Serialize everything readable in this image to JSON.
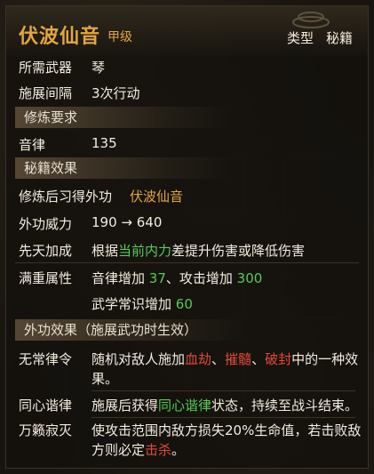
{
  "title": "伏波仙音",
  "grade": "甲级",
  "type": {
    "label": "类型",
    "value": "秘籍"
  },
  "rows": {
    "weapon": {
      "key": "所需武器",
      "value": "琴"
    },
    "interval": {
      "key": "施展间隔",
      "value": "3次行动"
    }
  },
  "sections": {
    "training": "修炼要求",
    "book_effect": "秘籍效果",
    "ext_effect": "外功效果（施展武功时生效）"
  },
  "training": {
    "key": "音律",
    "value": "135"
  },
  "book": {
    "obtain_key": "修炼后习得外功",
    "obtain_value": "伏波仙音",
    "power_key": "外功威力",
    "power_value": "190 → 640",
    "bonus_key": "先天加成",
    "bonus_pre": "根据",
    "bonus_hl": "当前内力",
    "bonus_post": "差提升伤害或降低伤害",
    "maxattr_key": "满重属性",
    "maxattr_l1_a": "音律增加 ",
    "maxattr_l1_b": "37",
    "maxattr_l1_c": "、攻击增加 ",
    "maxattr_l1_d": "300",
    "maxattr_l2_a": "武学常识增加 ",
    "maxattr_l2_b": "60"
  },
  "effects": [
    {
      "key": "无常律令",
      "l1_a": "随机对敌人施加",
      "l1_b": "血劫",
      "l1_c": "、",
      "l1_d": "摧髓",
      "l1_e": "、",
      "l1_f": "破封",
      "l1_g": "中的一种效",
      "l2": "果。"
    },
    {
      "key": "同心谐律",
      "l1_a": "施展后获得",
      "l1_b": "同心谐律",
      "l1_c": "状态，持续至战斗结束。"
    },
    {
      "key": "万籁寂灭",
      "l1": "使攻击范围内敌方损失20%生命值，若击败敌",
      "l2_a": "方则必定",
      "l2_b": "击杀",
      "l2_c": "。"
    }
  ],
  "colors": {
    "gold": "#e2a544",
    "green": "#5ac85a",
    "red": "#e04a3a"
  }
}
